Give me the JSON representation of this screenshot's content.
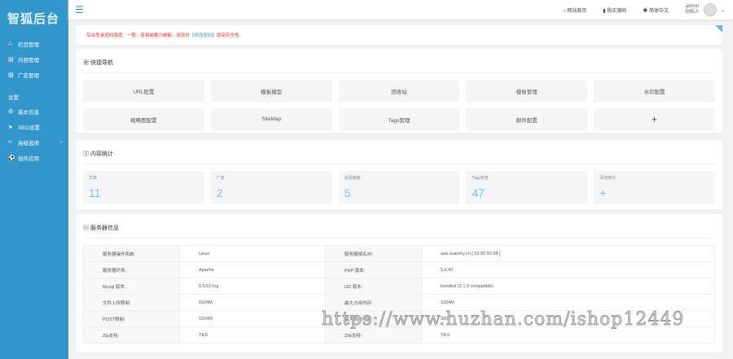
{
  "logo": "智狐后台",
  "sidebar": {
    "items": [
      {
        "icon": "sitemap-icon",
        "label": "栏目管理"
      },
      {
        "icon": "list-icon",
        "label": "内容管理"
      },
      {
        "icon": "image-icon",
        "label": "广告管理"
      }
    ],
    "section": "设置",
    "settings": [
      {
        "icon": "gear-icon",
        "label": "基本信息"
      },
      {
        "icon": "send-icon",
        "label": "SEO设置"
      },
      {
        "icon": "code-icon",
        "label": "高级选项"
      },
      {
        "icon": "plugin-icon",
        "label": "插件应用"
      }
    ]
  },
  "topbar": {
    "links": [
      "网站首页",
      "购买源码",
      "简体中文"
    ],
    "user": "admin",
    "role": "创始人"
  },
  "alert": {
    "text": "· 后台登录密码强度：一般，容易被暴力破解，请及时",
    "link": "【修改密码】",
    "suffix": "提高安全性。"
  },
  "quicknav": {
    "title": "快捷导航",
    "items": [
      "URL配置",
      "模板模型",
      "回收站",
      "模板管理",
      "水印配置",
      "缩略图配置",
      "SiteMap",
      "Tags管理",
      "邮件配置",
      "+"
    ]
  },
  "stats": {
    "title": "内容统计",
    "items": [
      {
        "label": "文章",
        "value": "11"
      },
      {
        "label": "广告",
        "value": "2"
      },
      {
        "label": "友情链接",
        "value": "5"
      },
      {
        "label": "Tags标签",
        "value": "47"
      },
      {
        "label": "添加统计",
        "value": "+"
      }
    ]
  },
  "server": {
    "title": "服务器信息",
    "rows": [
      [
        "服务器操作系统:",
        "Linux",
        "服务器域名/IP:",
        "aaa.suanmy.cn [ 52.80.50.98 ]"
      ],
      [
        "服务器环境:",
        "Apache",
        "PHP 版本:",
        "5.6.40"
      ],
      [
        "Mysql 版本:",
        "5.5.62-log",
        "GD 版本:",
        "bundled (2.1.0 compatible)"
      ],
      [
        "文件上传限制:",
        "1024M",
        "最大占用内存:",
        "1024M"
      ],
      [
        "POST限制:",
        "1024M",
        "最大执行时间:",
        "300s"
      ],
      [
        "Zip支持:",
        "YES",
        "Zlib支持:",
        "YES"
      ]
    ]
  },
  "watermark": "https://www.huzhan.com/ishop12449"
}
